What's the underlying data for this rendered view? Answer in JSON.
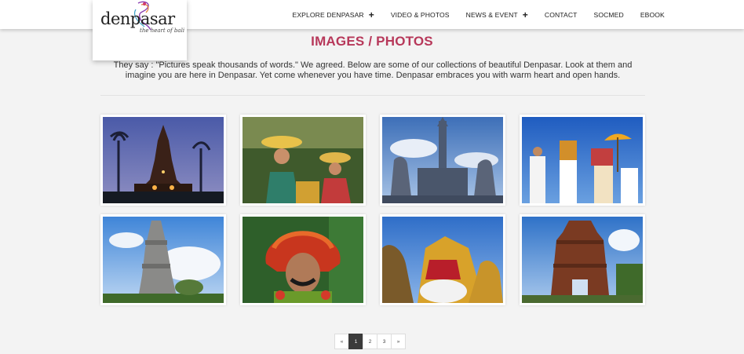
{
  "brand": {
    "logo_word": "denpasar",
    "tagline": "the heart of bali"
  },
  "nav": [
    {
      "label": "Explore Denpasar",
      "has_submenu": true
    },
    {
      "label": "Video & Photos",
      "has_submenu": false
    },
    {
      "label": "News & Event",
      "has_submenu": true
    },
    {
      "label": "Contact",
      "has_submenu": false
    },
    {
      "label": "Socmed",
      "has_submenu": false
    },
    {
      "label": "Ebook",
      "has_submenu": false
    }
  ],
  "page": {
    "title": "IMAGES / PHOTOS",
    "intro": "They say : \"Pictures speak thousands of words.\" We agreed. Below are some of our collections of beautiful Denpasar. Look at them and imagine you are here in Denpasar. Yet come whenever you have time. Denpasar embraces you with warm heart and open hands."
  },
  "gallery": [
    {
      "subject": "temple at dusk with palm trees"
    },
    {
      "subject": "traditional dancers with golden headdresses"
    },
    {
      "subject": "carved stone monument gate"
    },
    {
      "subject": "procession with parasols and offerings"
    },
    {
      "subject": "stone temple tower under blue sky"
    },
    {
      "subject": "masked dancer with red headdress"
    },
    {
      "subject": "golden barong costume"
    },
    {
      "subject": "brick temple gate"
    }
  ],
  "pagination": {
    "prev": "«",
    "pages": [
      "1",
      "2",
      "3"
    ],
    "current": "1",
    "next": "»"
  },
  "colors": {
    "accent": "#b7385a",
    "pager_active": "#3b3b3b"
  }
}
